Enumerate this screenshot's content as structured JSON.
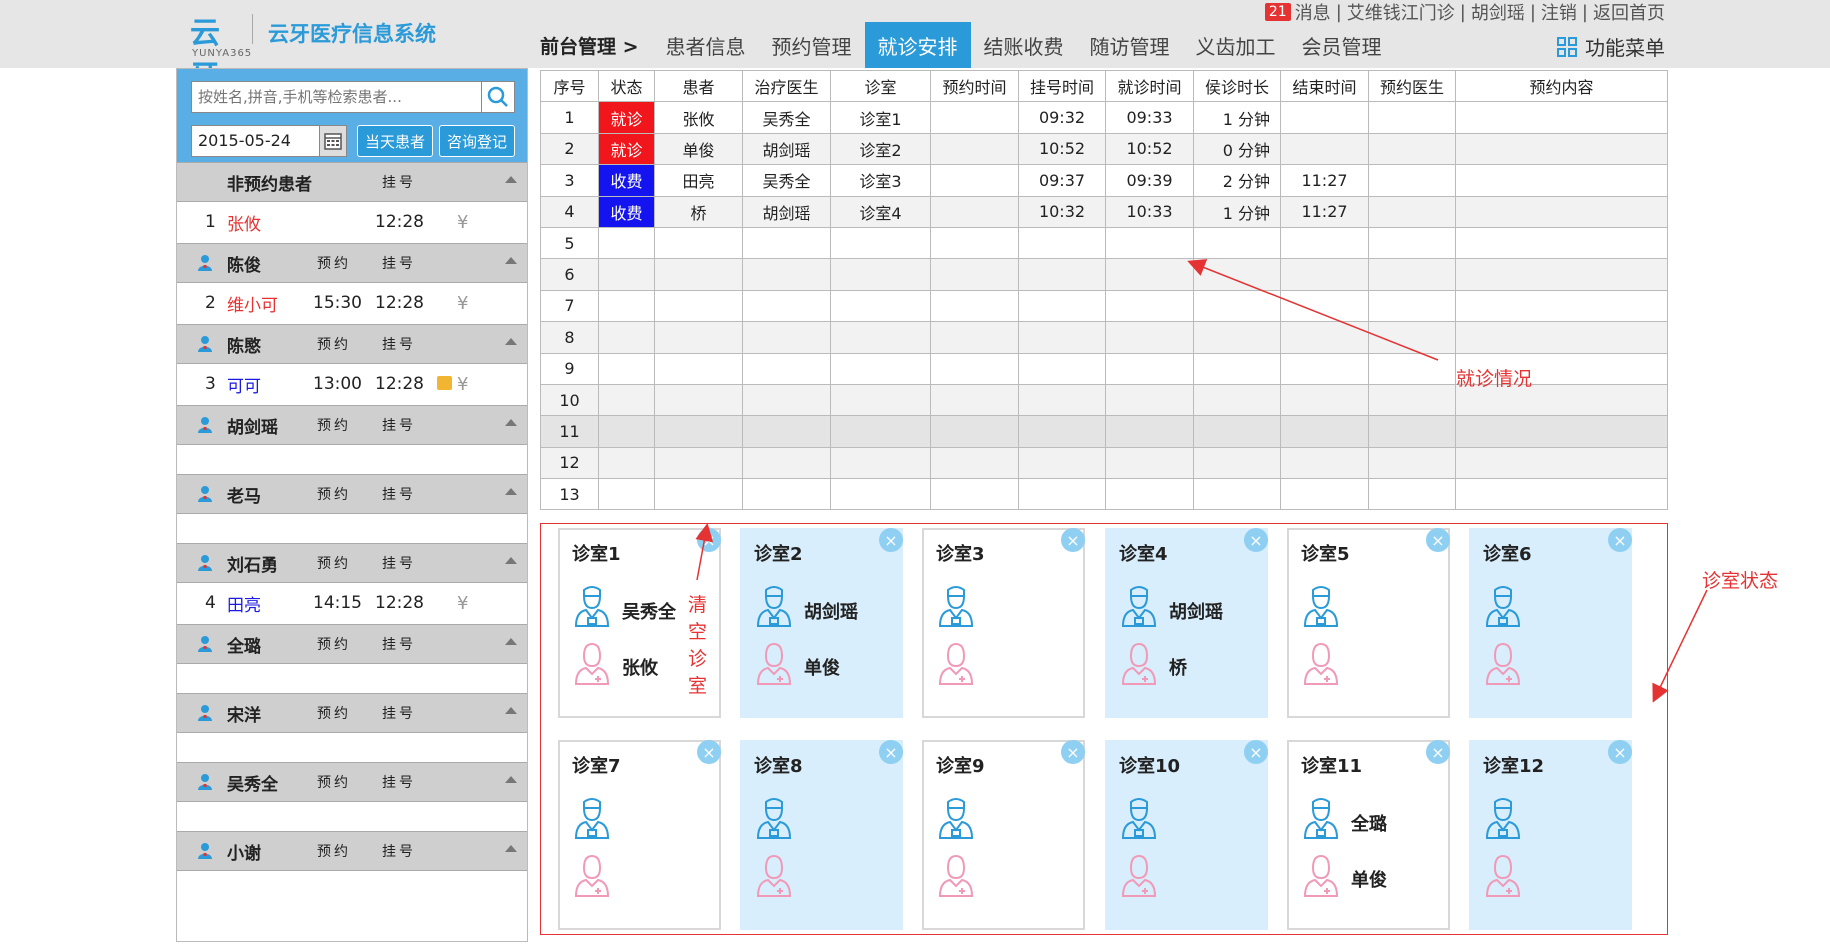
{
  "header": {
    "logo_glyph": "云牙",
    "logo_sub": "YUNYA365",
    "system_name": "云牙医疗信息系统",
    "links": {
      "message_count": "21",
      "messages": "消息",
      "clinic": "艾维钱江门诊",
      "user": "胡剑瑶",
      "logout": "注销",
      "home": "返回首页"
    },
    "breadcrumb": "前台管理 >",
    "tabs": [
      "患者信息",
      "预约管理",
      "就诊安排",
      "结账收费",
      "随访管理",
      "义齿加工",
      "会员管理"
    ],
    "active_tab": "就诊安排",
    "function_menu": "功能菜单"
  },
  "sidebar": {
    "search_placeholder": "按姓名,拼音,手机等检索患者...",
    "date": "2015-05-24",
    "today_button": "当天患者",
    "consult_button": "咨询登记",
    "groups": [
      {
        "name": "非预约患者",
        "icon": false,
        "label1": "",
        "label2": "挂号",
        "rows": [
          {
            "num": "1",
            "name": "张攸",
            "name_color": "#e53333",
            "t1": "",
            "t2": "12:28",
            "memo": false
          }
        ]
      },
      {
        "name": "陈俊",
        "icon": true,
        "label1": "预约",
        "label2": "挂号",
        "rows": [
          {
            "num": "2",
            "name": "维小可",
            "name_color": "#e53333",
            "t1": "15:30",
            "t2": "12:28",
            "memo": false
          }
        ]
      },
      {
        "name": "陈愍",
        "icon": true,
        "label1": "预约",
        "label2": "挂号",
        "rows": [
          {
            "num": "3",
            "name": "可可",
            "name_color": "#1a1ae0",
            "t1": "13:00",
            "t2": "12:28",
            "memo": true
          }
        ]
      },
      {
        "name": "胡剑瑶",
        "icon": true,
        "label1": "预约",
        "label2": "挂号",
        "rows": []
      },
      {
        "name": "老马",
        "icon": true,
        "label1": "预约",
        "label2": "挂号",
        "rows": []
      },
      {
        "name": "刘石勇",
        "icon": true,
        "label1": "预约",
        "label2": "挂号",
        "rows": [
          {
            "num": "4",
            "name": "田亮",
            "name_color": "#1a1ae0",
            "t1": "14:15",
            "t2": "12:28",
            "memo": false
          }
        ]
      },
      {
        "name": "全璐",
        "icon": true,
        "label1": "预约",
        "label2": "挂号",
        "rows": []
      },
      {
        "name": "宋洋",
        "icon": true,
        "label1": "预约",
        "label2": "挂号",
        "rows": []
      },
      {
        "name": "吴秀全",
        "icon": true,
        "label1": "预约",
        "label2": "挂号",
        "rows": []
      },
      {
        "name": "小谢",
        "icon": true,
        "label1": "预约",
        "label2": "挂号",
        "rows": []
      }
    ],
    "yen_symbol": "¥"
  },
  "visit_table": {
    "columns": [
      "序号",
      "状态",
      "患者",
      "治疗医生",
      "诊室",
      "预约时间",
      "挂号时间",
      "就诊时间",
      "侯诊时长",
      "结束时间",
      "预约医生",
      "预约内容"
    ],
    "rows": [
      [
        "1",
        "就诊",
        "张攸",
        "吴秀全",
        "诊室1",
        "",
        "09:32",
        "09:33",
        "1 分钟",
        "",
        "",
        ""
      ],
      [
        "2",
        "就诊",
        "单俊",
        "胡剑瑶",
        "诊室2",
        "",
        "10:52",
        "10:52",
        "0 分钟",
        "",
        "",
        ""
      ],
      [
        "3",
        "收费",
        "田亮",
        "吴秀全",
        "诊室3",
        "",
        "09:37",
        "09:39",
        "2 分钟",
        "11:27",
        "",
        ""
      ],
      [
        "4",
        "收费",
        "桥",
        "胡剑瑶",
        "诊室4",
        "",
        "10:32",
        "10:33",
        "1 分钟",
        "11:27",
        "",
        ""
      ],
      [
        "5",
        "",
        "",
        "",
        "",
        "",
        "",
        "",
        "",
        "",
        "",
        ""
      ],
      [
        "6",
        "",
        "",
        "",
        "",
        "",
        "",
        "",
        "",
        "",
        "",
        ""
      ],
      [
        "7",
        "",
        "",
        "",
        "",
        "",
        "",
        "",
        "",
        "",
        "",
        ""
      ],
      [
        "8",
        "",
        "",
        "",
        "",
        "",
        "",
        "",
        "",
        "",
        "",
        ""
      ],
      [
        "9",
        "",
        "",
        "",
        "",
        "",
        "",
        "",
        "",
        "",
        "",
        ""
      ],
      [
        "10",
        "",
        "",
        "",
        "",
        "",
        "",
        "",
        "",
        "",
        "",
        ""
      ],
      [
        "11",
        "",
        "",
        "",
        "",
        "",
        "",
        "",
        "",
        "",
        "",
        ""
      ],
      [
        "12",
        "",
        "",
        "",
        "",
        "",
        "",
        "",
        "",
        "",
        "",
        ""
      ],
      [
        "13",
        "",
        "",
        "",
        "",
        "",
        "",
        "",
        "",
        "",
        "",
        ""
      ]
    ],
    "status_colors": {
      "就诊": "#f0161b",
      "收费": "#1414f0"
    }
  },
  "rooms": [
    {
      "name": "诊室1",
      "doctor": "吴秀全",
      "patient": "张攸"
    },
    {
      "name": "诊室2",
      "doctor": "胡剑瑶",
      "patient": "单俊"
    },
    {
      "name": "诊室3",
      "doctor": "",
      "patient": ""
    },
    {
      "name": "诊室4",
      "doctor": "胡剑瑶",
      "patient": "桥"
    },
    {
      "name": "诊室5",
      "doctor": "",
      "patient": ""
    },
    {
      "name": "诊室6",
      "doctor": "",
      "patient": ""
    },
    {
      "name": "诊室7",
      "doctor": "",
      "patient": ""
    },
    {
      "name": "诊室8",
      "doctor": "",
      "patient": ""
    },
    {
      "name": "诊室9",
      "doctor": "",
      "patient": ""
    },
    {
      "name": "诊室10",
      "doctor": "",
      "patient": ""
    },
    {
      "name": "诊室11",
      "doctor": "全璐",
      "patient": "单俊"
    },
    {
      "name": "诊室12",
      "doctor": "",
      "patient": ""
    }
  ],
  "annotations": {
    "visit_status": "就诊情况",
    "room_status": "诊室状态",
    "clear_room": "清空诊室"
  },
  "colors": {
    "accent": "#2a9ad8",
    "annotation": "#e53333",
    "room_blue": "#d9eefc"
  }
}
